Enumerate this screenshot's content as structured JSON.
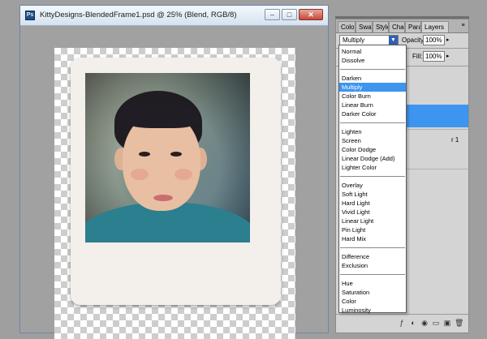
{
  "document": {
    "title": "KittyDesigns-BlendedFrame1.psd @ 25% (Blend, RGB/8)",
    "app_icon_text": "Ps",
    "buttons": {
      "minimize": "–",
      "maximize": "□",
      "close": "✕"
    }
  },
  "panel": {
    "tabs": [
      "Colo",
      "Swat",
      "Style",
      "Char",
      "Para",
      "Layers"
    ],
    "active_tab": "Layers",
    "menu_glyph": "≡",
    "blend_mode": "Multiply",
    "opacity_label": "Opacity:",
    "opacity_value": "100%",
    "fill_label": "Fill:",
    "fill_value": "100%",
    "partial_layer_text": "r 1",
    "bottom_icons": [
      "link-icon",
      "fx-icon",
      "mask-icon",
      "adjustment-icon",
      "folder-icon",
      "new-layer-icon",
      "trash-icon"
    ]
  },
  "blend_menu": {
    "groups": [
      [
        "Normal",
        "Dissolve"
      ],
      [
        "Darken",
        "Multiply",
        "Color Burn",
        "Linear Burn",
        "Darker Color"
      ],
      [
        "Lighten",
        "Screen",
        "Color Dodge",
        "Linear Dodge (Add)",
        "Lighter Color"
      ],
      [
        "Overlay",
        "Soft Light",
        "Hard Light",
        "Vivid Light",
        "Linear Light",
        "Pin Light",
        "Hard Mix"
      ],
      [
        "Difference",
        "Exclusion"
      ],
      [
        "Hue",
        "Saturation",
        "Color",
        "Luminosity"
      ]
    ],
    "selected": "Multiply"
  },
  "colors": {
    "selection": "#3d95f0",
    "panel": "#d4d4d4",
    "workspace": "#9f9f9f"
  }
}
